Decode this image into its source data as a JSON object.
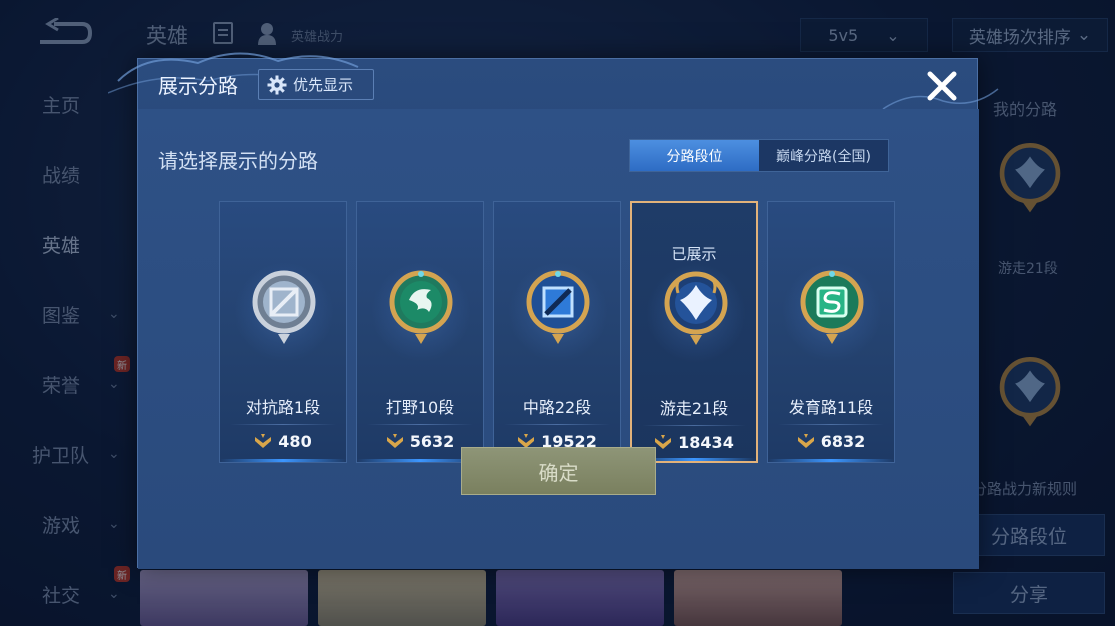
{
  "background": {
    "top_title": "英雄",
    "top_subtitle": "英雄战力",
    "mode_select": "5v5",
    "sort_select": "英雄场次排序",
    "side_nav": [
      {
        "label": "主页",
        "has_chevron": false,
        "new_badge": false,
        "active": false
      },
      {
        "label": "战绩",
        "has_chevron": false,
        "new_badge": false,
        "active": false
      },
      {
        "label": "英雄",
        "has_chevron": false,
        "new_badge": false,
        "active": true
      },
      {
        "label": "图鉴",
        "has_chevron": true,
        "new_badge": false,
        "active": false
      },
      {
        "label": "荣誉",
        "has_chevron": true,
        "new_badge": true,
        "active": false
      },
      {
        "label": "护卫队",
        "has_chevron": true,
        "new_badge": false,
        "active": false
      },
      {
        "label": "游戏",
        "has_chevron": true,
        "new_badge": false,
        "active": false
      },
      {
        "label": "社交",
        "has_chevron": true,
        "new_badge": true,
        "active": false
      }
    ],
    "new_badge_text": "新",
    "right_panel": {
      "title": "我的分路",
      "emblem_label": "游走21段",
      "rule_text": "分路战力新规则",
      "lane_rank_button": "分路段位",
      "share_button": "分享"
    }
  },
  "modal": {
    "title": "展示分路",
    "priority_button": "优先显示",
    "prompt": "请选择展示的分路",
    "tabs": [
      {
        "label": "分路段位",
        "active": true
      },
      {
        "label": "巅峰分路(全国)",
        "active": false
      }
    ],
    "shown_label": "已展示",
    "cards": [
      {
        "name": "对抗路1段",
        "score": "480",
        "emblem": "clash-lane",
        "selected": false
      },
      {
        "name": "打野10段",
        "score": "5632",
        "emblem": "jungle",
        "selected": false
      },
      {
        "name": "中路22段",
        "score": "19522",
        "emblem": "mid-lane",
        "selected": false
      },
      {
        "name": "游走21段",
        "score": "18434",
        "emblem": "roam",
        "selected": true
      },
      {
        "name": "发育路11段",
        "score": "6832",
        "emblem": "farm-lane",
        "selected": false
      }
    ],
    "confirm_button": "确定"
  },
  "colors": {
    "selected_border": "#e2b27a",
    "tab_active": "#3c7fd6",
    "gold": "#d9a64a",
    "confirm_bg": "#858b6b"
  }
}
